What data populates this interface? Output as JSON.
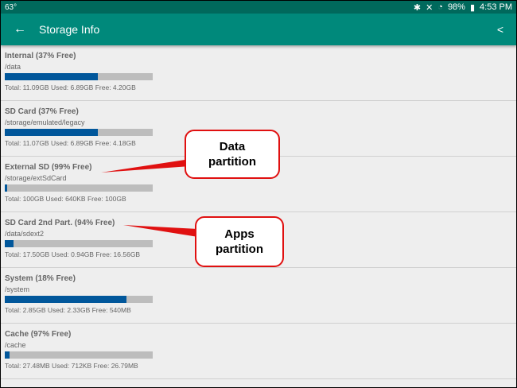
{
  "status": {
    "temp": "63°",
    "battery": "98%",
    "time": "4:53 PM"
  },
  "appbar": {
    "title": "Storage Info"
  },
  "items": [
    {
      "title": "Internal (37% Free)",
      "path": "/data",
      "summary": "Total: 11.09GB Used: 6.89GB Free: 4.20GB",
      "used_pct": 63
    },
    {
      "title": "SD Card (37% Free)",
      "path": "/storage/emulated/legacy",
      "summary": "Total: 11.07GB Used: 6.89GB Free: 4.18GB",
      "used_pct": 63
    },
    {
      "title": "External SD (99% Free)",
      "path": "/storage/extSdCard",
      "summary": "Total: 100GB Used: 640KB Free: 100GB",
      "used_pct": 1.5
    },
    {
      "title": "SD Card 2nd Part. (94% Free)",
      "path": "/data/sdext2",
      "summary": "Total: 17.50GB Used: 0.94GB Free: 16.56GB",
      "used_pct": 6
    },
    {
      "title": "System (18% Free)",
      "path": "/system",
      "summary": "Total: 2.85GB Used: 2.33GB Free: 540MB",
      "used_pct": 82
    },
    {
      "title": "Cache (97% Free)",
      "path": "/cache",
      "summary": "Total: 27.48MB Used: 712KB Free: 26.79MB",
      "used_pct": 3
    }
  ],
  "callouts": {
    "data": "Data partition",
    "apps": "Apps partition"
  }
}
